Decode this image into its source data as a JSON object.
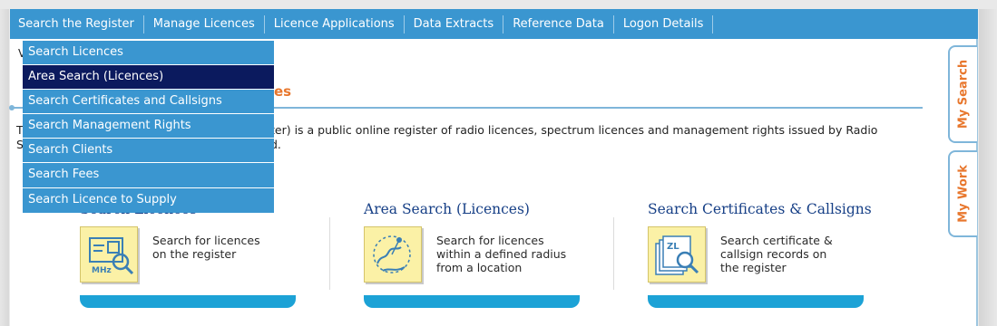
{
  "nav": {
    "items": [
      {
        "label": "Search the Register"
      },
      {
        "label": "Manage Licences"
      },
      {
        "label": "Licence Applications"
      },
      {
        "label": "Data Extracts"
      },
      {
        "label": "Reference Data"
      },
      {
        "label": "Logon Details"
      }
    ]
  },
  "dropdown": {
    "items": [
      {
        "label": "Search Licences",
        "active": false
      },
      {
        "label": "Area Search (Licences)",
        "active": true
      },
      {
        "label": "Search Certificates and Callsigns",
        "active": false
      },
      {
        "label": "Search Management Rights",
        "active": false
      },
      {
        "label": "Search Clients",
        "active": false
      },
      {
        "label": "Search Fees",
        "active": false
      },
      {
        "label": "Search Licence to Supply",
        "active": false
      }
    ]
  },
  "partial": {
    "welcome_fragment": "V",
    "title_fragment": "es",
    "intro_line1_start": "T",
    "intro_line1_visible": "ter) is a public online register of radio licences, spectrum licences and management rights issued by Radio",
    "intro_line2_start": "S",
    "intro_line2_visible": "d."
  },
  "cards": [
    {
      "title": "Search Licences",
      "description": "Search for licences\non the register",
      "icon": "licence-search-icon"
    },
    {
      "title": "Area Search (Licences)",
      "description": "Search for licences\nwithin a defined radius\nfrom a location",
      "icon": "map-radius-icon"
    },
    {
      "title": "Search Certificates & Callsigns",
      "description": "Search certificate &\ncallsign records on\nthe register",
      "icon": "certificate-search-icon"
    }
  ],
  "side_tabs": [
    {
      "label": "My Search"
    },
    {
      "label": "My Work"
    }
  ],
  "colors": {
    "nav_bg": "#3a96d0",
    "active_item_bg": "#0b1a5e",
    "title_orange": "#e8772d",
    "card_title_blue": "#163f86",
    "card_button": "#1ca2d6"
  }
}
